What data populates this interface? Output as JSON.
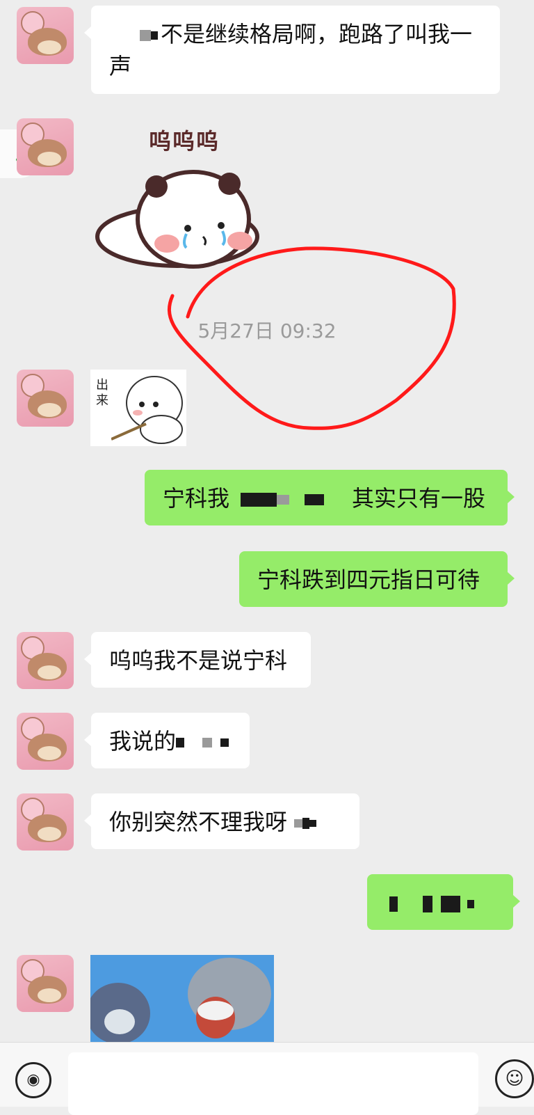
{
  "messages": {
    "m1": "不是继续格局啊，跑路了叫我一声",
    "sticker1_caption": "呜呜呜",
    "timestamp": "5月27日 09:32",
    "sticker2_caption": "出来",
    "m2_prefix": "宁科我",
    "m2_suffix": "其实只有一股",
    "m3": "宁科跌到四元指日可待",
    "m4": "呜呜我不是说宁科",
    "m5": "我说的",
    "m6": "你别突然不理我呀"
  },
  "colors": {
    "background": "#ededed",
    "bubble_self": "#95ec69",
    "bubble_other": "#ffffff",
    "annotation": "#ff1a1a"
  },
  "icons": {
    "voice": "voice-icon",
    "emoji": "emoji-icon",
    "music": "music-note-icon"
  }
}
